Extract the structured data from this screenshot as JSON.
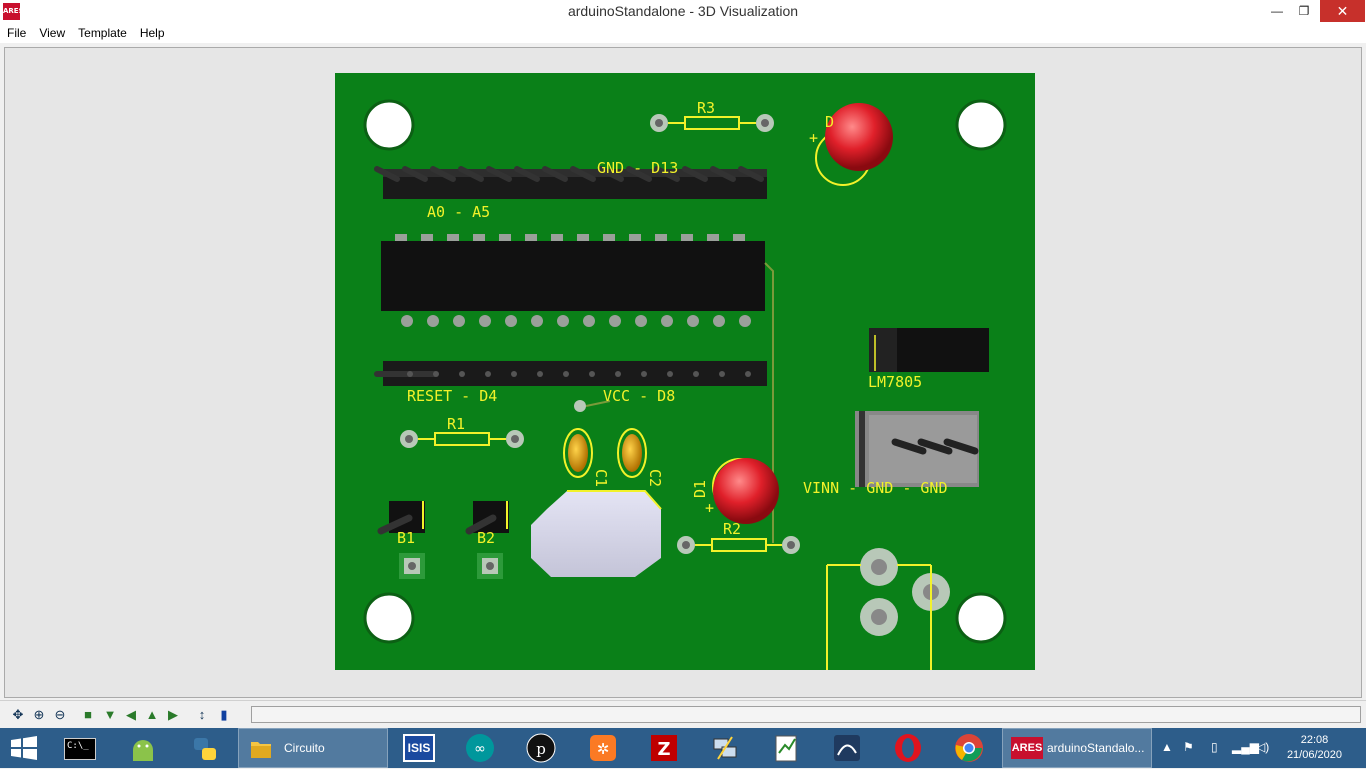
{
  "window": {
    "title": "arduinoStandalone - 3D Visualization",
    "app_icon_text": "ARES",
    "minimize": "—",
    "restore": "❐",
    "close": "✕"
  },
  "menu": {
    "items": [
      "File",
      "View",
      "Template",
      "Help"
    ]
  },
  "board": {
    "labels": {
      "r3": "R3",
      "gnd_d13": "GND - D13",
      "a0_a5": "A0 - A5",
      "d_led": "D",
      "lm7805": "LM7805",
      "reset_d4": "RESET - D4",
      "vcc_d8": "VCC - D8",
      "r1": "R1",
      "c1": "C1",
      "c2": "C2",
      "d1": "D1",
      "r2": "R2",
      "vinn": "VINN - GND - GND",
      "b1": "B1",
      "b2": "B2",
      "plus1": "+",
      "plus2": "+"
    }
  },
  "toolbar": {
    "icons": [
      "pan-icon",
      "zoom-in-icon",
      "zoom-out-icon",
      "view-top-icon",
      "view-front-icon",
      "view-left-icon",
      "view-back-icon",
      "view-right-icon",
      "height-icon",
      "board-icon"
    ]
  },
  "taskbar": {
    "explorer_label": "Circuito",
    "ares_label": "arduinoStandalo...",
    "ares_icon": "ARES",
    "isis_icon": "ISIS",
    "time": "22:08",
    "date": "21/06/2020"
  },
  "colors": {
    "pcb": "#0a8018",
    "silkscreen": "#f2f22a",
    "taskbar": "#2d5d8a",
    "led": "#e0202a"
  }
}
